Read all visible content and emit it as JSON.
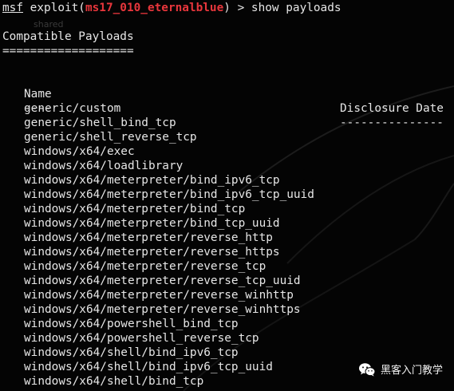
{
  "prompt": {
    "msf": "msf",
    "exploit_open": " exploit(",
    "module": "ms17_010_eternalblue",
    "exploit_close": ") > ",
    "command": "show payloads"
  },
  "faint_text": "shared",
  "section_title": "Compatible Payloads",
  "section_rule": "===================",
  "table": {
    "headers": {
      "name": "Name",
      "disclosure_date": "Disclosure Date"
    },
    "header_rules": {
      "name": "----",
      "disclosure_date": "---------------"
    },
    "rows": [
      "generic/custom",
      "generic/shell_bind_tcp",
      "generic/shell_reverse_tcp",
      "windows/x64/exec",
      "windows/x64/loadlibrary",
      "windows/x64/meterpreter/bind_ipv6_tcp",
      "windows/x64/meterpreter/bind_ipv6_tcp_uuid",
      "windows/x64/meterpreter/bind_tcp",
      "windows/x64/meterpreter/bind_tcp_uuid",
      "windows/x64/meterpreter/reverse_http",
      "windows/x64/meterpreter/reverse_https",
      "windows/x64/meterpreter/reverse_tcp",
      "windows/x64/meterpreter/reverse_tcp_uuid",
      "windows/x64/meterpreter/reverse_winhttp",
      "windows/x64/meterpreter/reverse_winhttps",
      "windows/x64/powershell_bind_tcp",
      "windows/x64/powershell_reverse_tcp",
      "windows/x64/shell/bind_ipv6_tcp",
      "windows/x64/shell/bind_ipv6_tcp_uuid",
      "windows/x64/shell/bind_tcp"
    ]
  },
  "watermark": {
    "icon": "wechat-icon",
    "text": "黑客入门教学"
  },
  "colors": {
    "background": "#040404",
    "text": "#e6e6e6",
    "module": "#e8363c"
  }
}
